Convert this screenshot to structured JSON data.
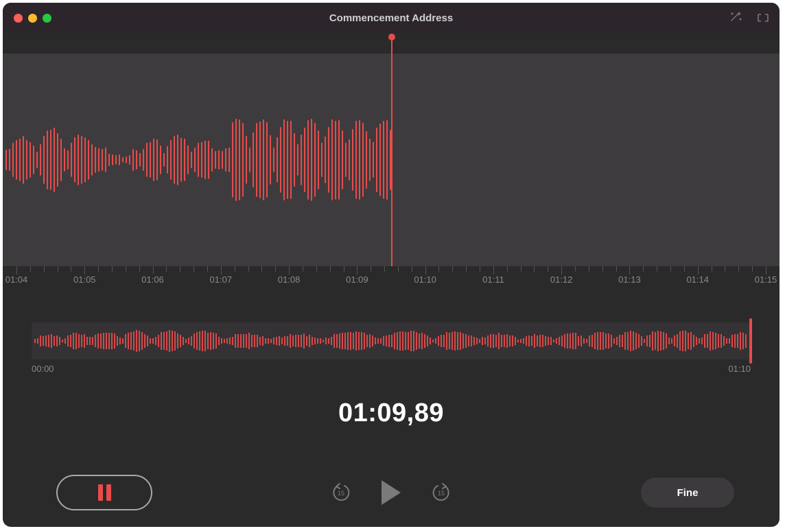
{
  "window": {
    "title": "Commencement Address"
  },
  "colors": {
    "accent": "#e94b4b"
  },
  "waveform": {
    "playhead_position_percent": 50,
    "ruler_ticks": [
      "01:04",
      "01:05",
      "01:06",
      "01:07",
      "01:08",
      "01:09",
      "01:10",
      "01:11",
      "01:12",
      "01:13",
      "01:14",
      "01:15"
    ]
  },
  "overview": {
    "start_label": "00:00",
    "end_label": "01:10"
  },
  "time": {
    "current": "01:09,89"
  },
  "controls": {
    "skip_back_seconds": "15",
    "skip_forward_seconds": "15",
    "done_label": "Fine"
  },
  "toolbar_icons": {
    "enhance": "enhance-icon",
    "trim": "trim-icon"
  }
}
